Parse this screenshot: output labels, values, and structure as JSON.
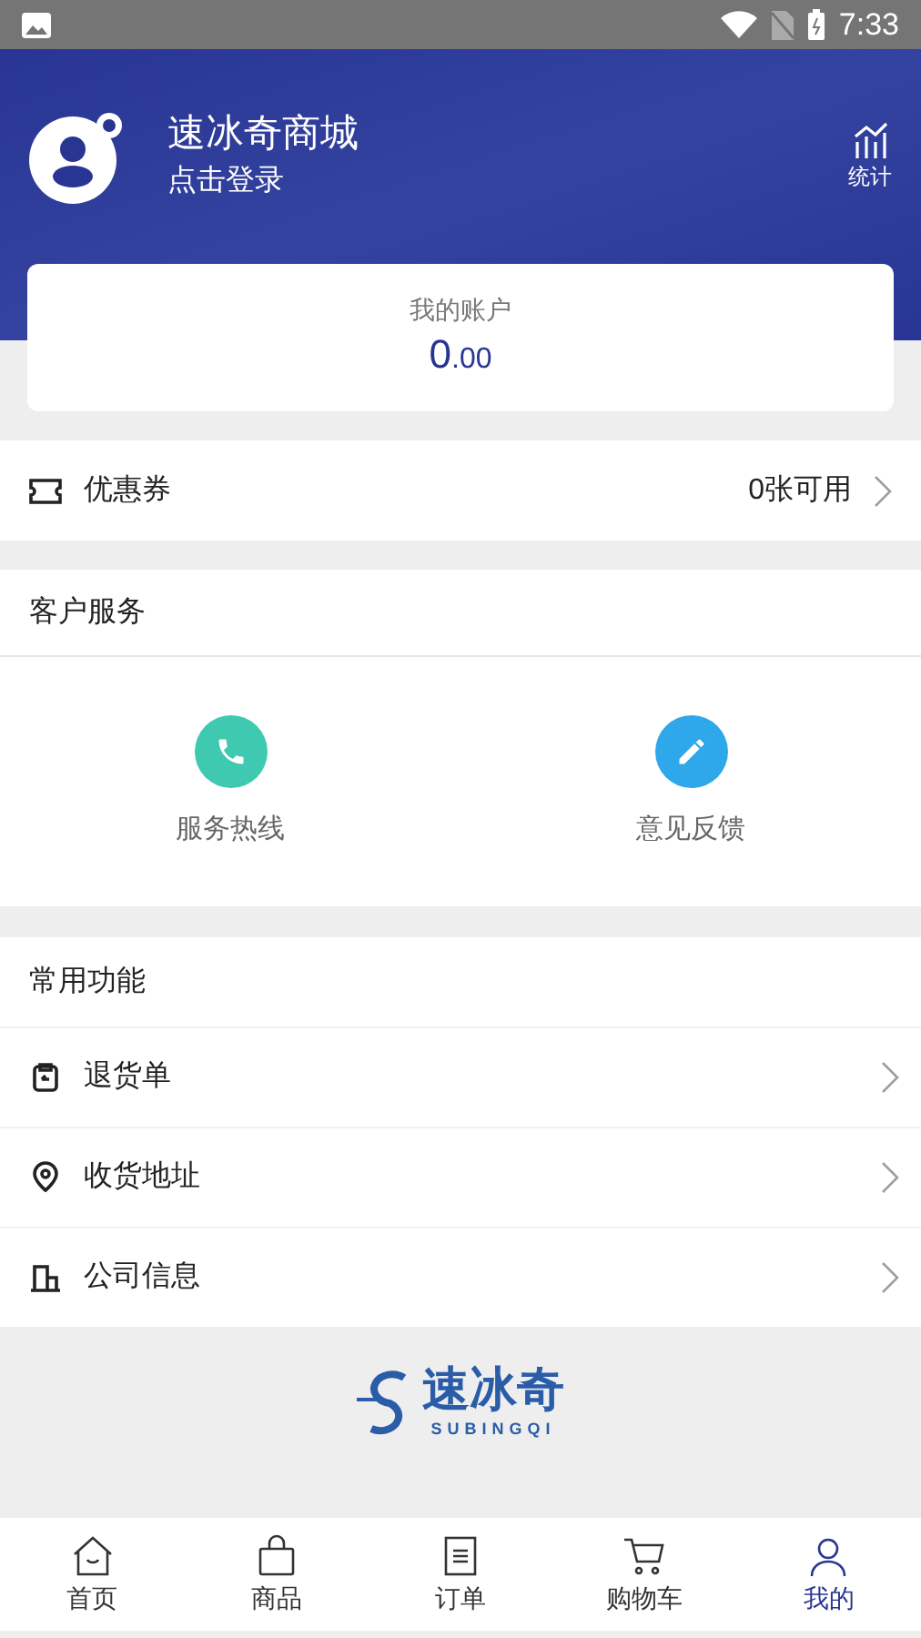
{
  "status_bar": {
    "time": "7:33"
  },
  "profile": {
    "shop_name": "速冰奇商城",
    "login_prompt": "点击登录",
    "stats_label": "统计"
  },
  "account": {
    "label": "我的账户",
    "balance_int": "0",
    "balance_dec": ".00"
  },
  "coupon": {
    "label": "优惠券",
    "value": "0张可用"
  },
  "customer_service": {
    "title": "客户服务",
    "items": [
      {
        "label": "服务热线",
        "kind": "phone",
        "color": "#3ec9b0"
      },
      {
        "label": "意见反馈",
        "kind": "feedback",
        "color": "#2ea8ea"
      }
    ]
  },
  "common_functions": {
    "title": "常用功能",
    "items": [
      {
        "label": "退货单",
        "kind": "return"
      },
      {
        "label": "收货地址",
        "kind": "address"
      },
      {
        "label": "公司信息",
        "kind": "company"
      }
    ]
  },
  "brand": {
    "name": "速冰奇",
    "latin": "SUBINGQI"
  },
  "tab_bar": [
    {
      "label": "首页",
      "kind": "home",
      "selected": false
    },
    {
      "label": "商品",
      "kind": "goods",
      "selected": false
    },
    {
      "label": "订单",
      "kind": "orders",
      "selected": false
    },
    {
      "label": "购物车",
      "kind": "cart",
      "selected": false
    },
    {
      "label": "我的",
      "kind": "me",
      "selected": true
    }
  ]
}
